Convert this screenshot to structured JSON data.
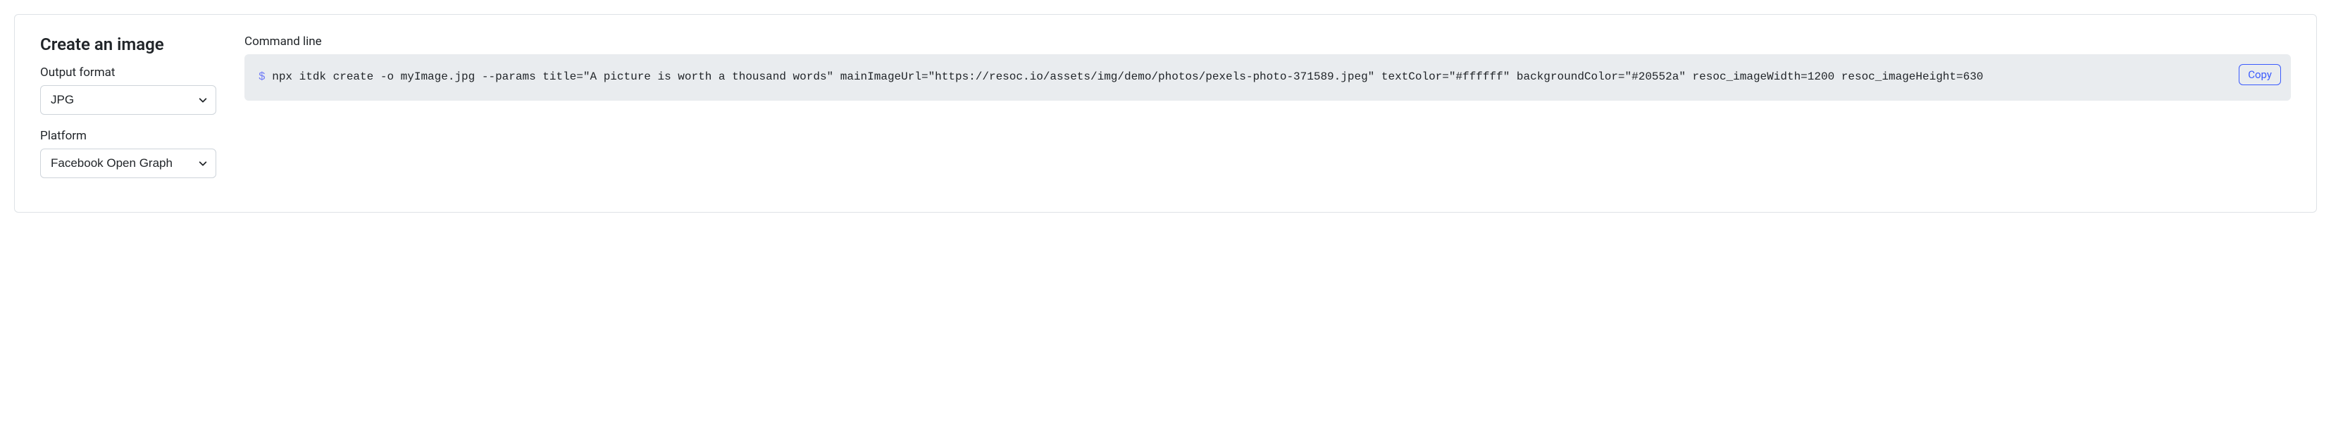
{
  "section": {
    "title": "Create an image"
  },
  "form": {
    "output_format": {
      "label": "Output format",
      "selected": "JPG"
    },
    "platform": {
      "label": "Platform",
      "selected": "Facebook Open Graph"
    }
  },
  "command": {
    "label": "Command line",
    "prompt": "$",
    "text": " npx itdk create -o myImage.jpg --params title=\"A picture is worth a thousand words\" mainImageUrl=\"https://resoc.io/assets/img/demo/photos/pexels-photo-371589.jpeg\" textColor=\"#ffffff\" backgroundColor=\"#20552a\" resoc_imageWidth=1200 resoc_imageHeight=630",
    "copy_label": "Copy"
  }
}
